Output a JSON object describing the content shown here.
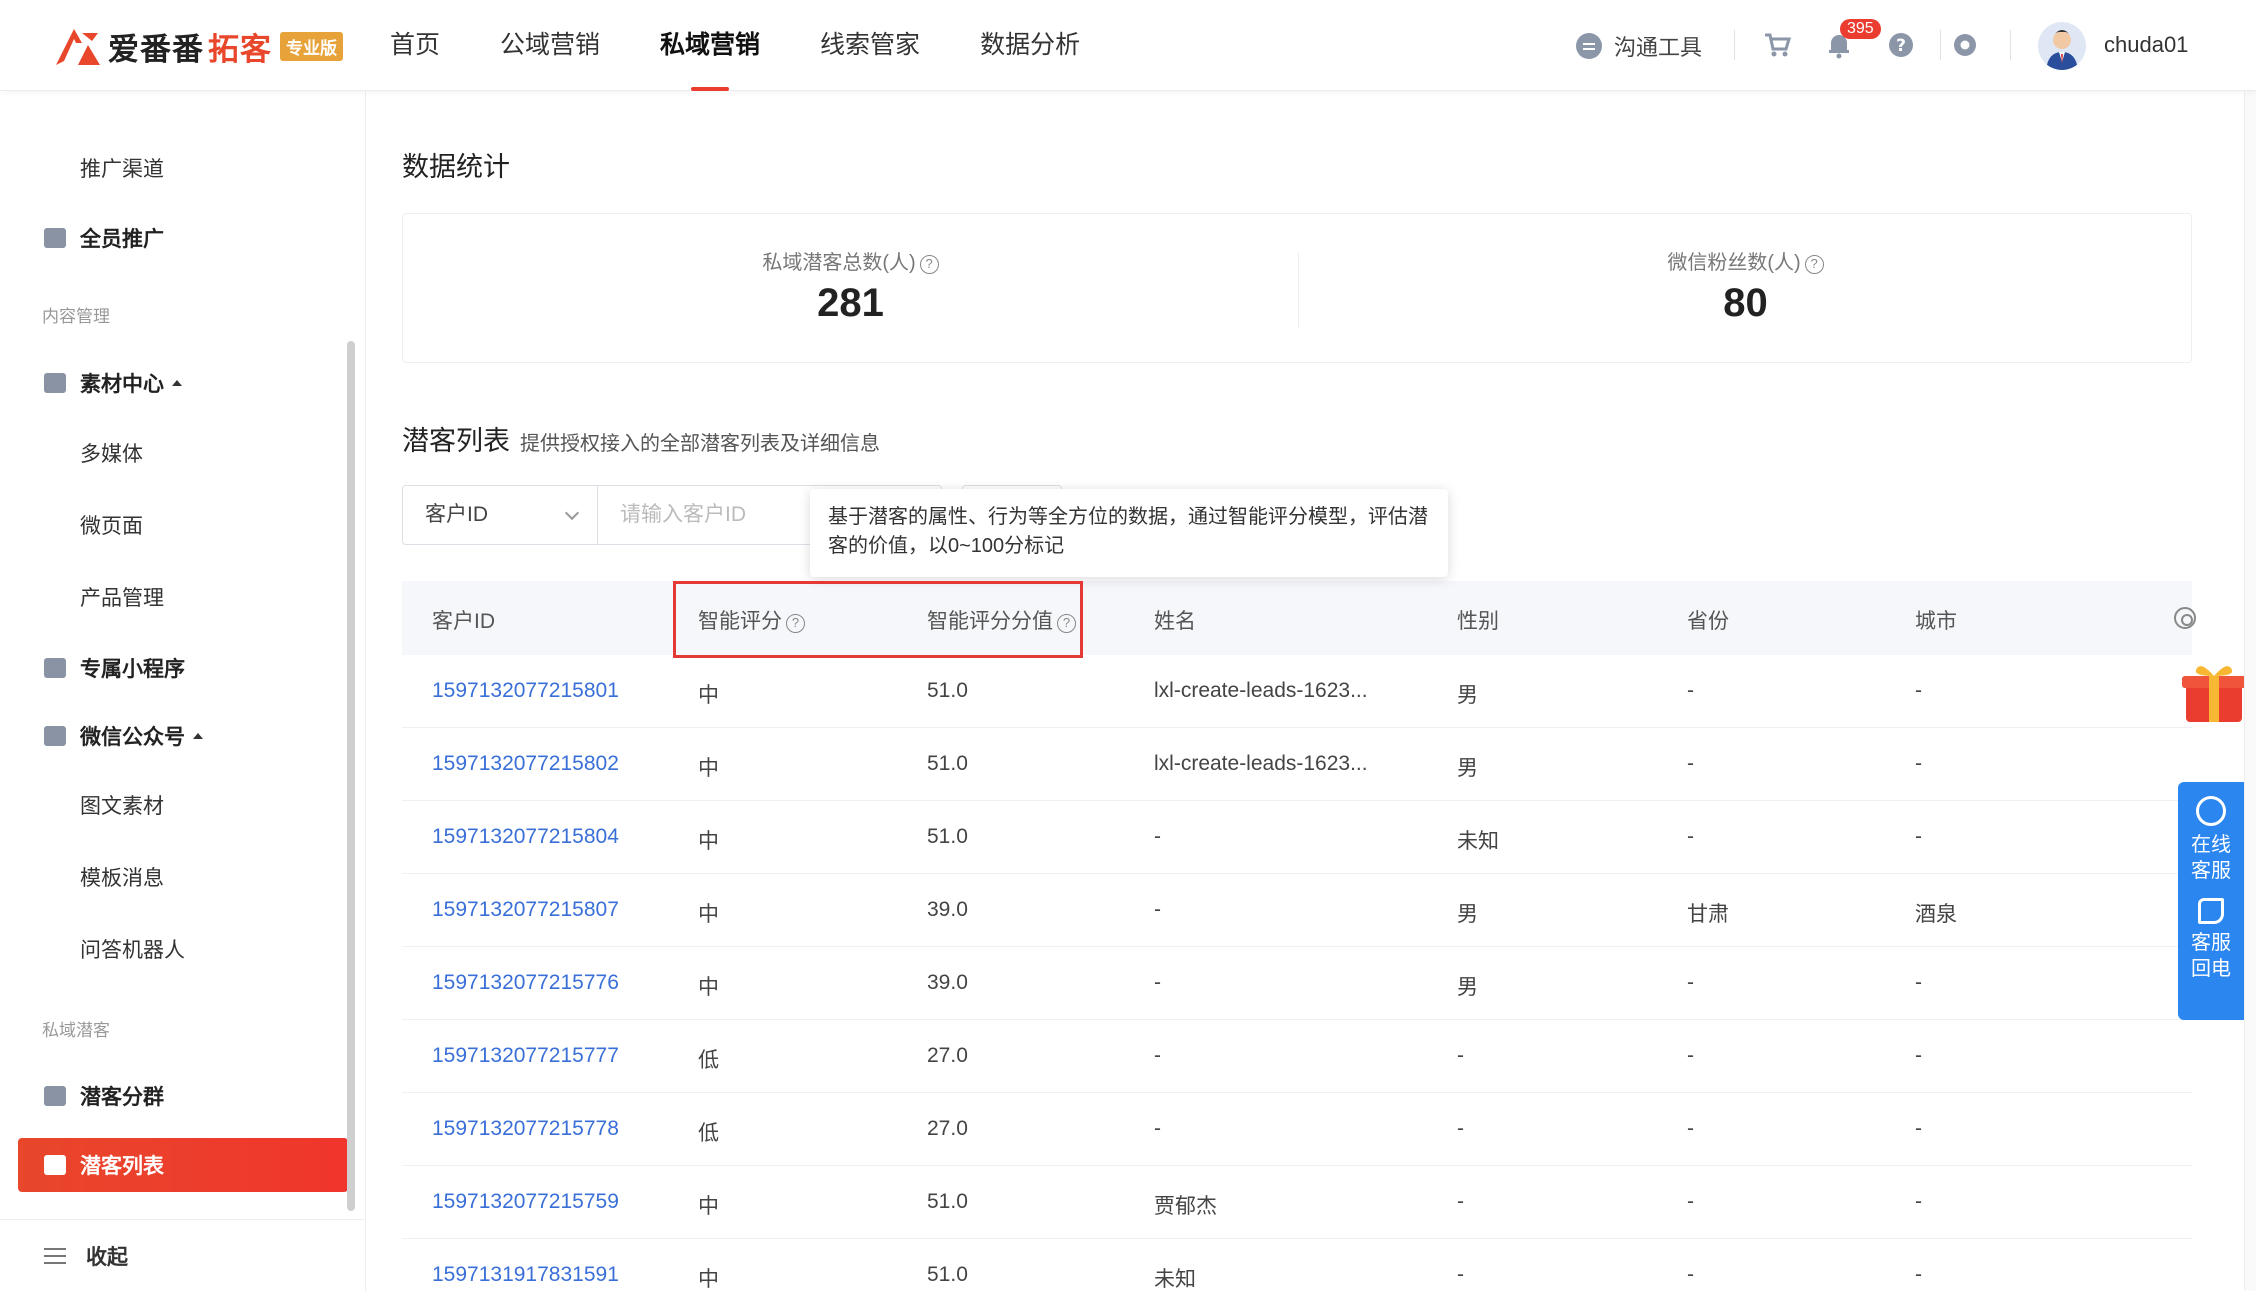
{
  "header": {
    "brand": "爱番番",
    "brand_product": "拓客",
    "brand_badge": "专业版",
    "nav": [
      {
        "label": "首页",
        "active": false
      },
      {
        "label": "公域营销",
        "active": false
      },
      {
        "label": "私域营销",
        "active": true
      },
      {
        "label": "线索管家",
        "active": false
      },
      {
        "label": "数据分析",
        "active": false
      }
    ],
    "comm_tool": "沟通工具",
    "notification_count": "395",
    "username": "chuda01"
  },
  "sidebar": {
    "items": {
      "promo_channel": "推广渠道",
      "all_staff": "全员推广",
      "group_content": "内容管理",
      "material_center": "素材中心",
      "multimedia": "多媒体",
      "micro_page": "微页面",
      "product_mgmt": "产品管理",
      "mini_program": "专属小程序",
      "wechat_official": "微信公众号",
      "image_text": "图文素材",
      "template_msg": "模板消息",
      "qa_bot": "问答机器人",
      "group_private": "私域潜客",
      "lead_group": "潜客分群",
      "lead_list": "潜客列表"
    },
    "collapse": "收起"
  },
  "main": {
    "stats_title": "数据统计",
    "stats": [
      {
        "label": "私域潜客总数(人)",
        "value": "281"
      },
      {
        "label": "微信粉丝数(人)",
        "value": "80"
      }
    ],
    "list_title": "潜客列表",
    "list_subtitle": "提供授权接入的全部潜客列表及详细信息",
    "filter": {
      "select_value": "客户ID",
      "input_placeholder": "请输入客户ID"
    },
    "tooltip": "基于潜客的属性、行为等全方位的数据，通过智能评分模型，评估潜客的价值，以0~100分标记",
    "columns": [
      "客户ID",
      "智能评分",
      "智能评分分值",
      "姓名",
      "性别",
      "省份",
      "城市"
    ],
    "rows": [
      {
        "id": "1597132077215801",
        "score": "中",
        "score_value": "51.0",
        "name": "lxl-create-leads-1623...",
        "gender": "男",
        "province": "-",
        "city": "-"
      },
      {
        "id": "1597132077215802",
        "score": "中",
        "score_value": "51.0",
        "name": "lxl-create-leads-1623...",
        "gender": "男",
        "province": "-",
        "city": "-"
      },
      {
        "id": "1597132077215804",
        "score": "中",
        "score_value": "51.0",
        "name": "-",
        "gender": "未知",
        "province": "-",
        "city": "-"
      },
      {
        "id": "1597132077215807",
        "score": "中",
        "score_value": "39.0",
        "name": "-",
        "gender": "男",
        "province": "甘肃",
        "city": "酒泉"
      },
      {
        "id": "1597132077215776",
        "score": "中",
        "score_value": "39.0",
        "name": "-",
        "gender": "男",
        "province": "-",
        "city": "-"
      },
      {
        "id": "1597132077215777",
        "score": "低",
        "score_value": "27.0",
        "name": "-",
        "gender": "-",
        "province": "-",
        "city": "-"
      },
      {
        "id": "1597132077215778",
        "score": "低",
        "score_value": "27.0",
        "name": "-",
        "gender": "-",
        "province": "-",
        "city": "-"
      },
      {
        "id": "1597132077215759",
        "score": "中",
        "score_value": "51.0",
        "name": "贾郁杰",
        "gender": "-",
        "province": "-",
        "city": "-"
      },
      {
        "id": "1597131917831591",
        "score": "中",
        "score_value": "51.0",
        "name": "未知",
        "gender": "-",
        "province": "-",
        "city": "-"
      }
    ]
  },
  "float": {
    "online_service": "在线客服",
    "callback": "客服回电"
  },
  "colors": {
    "brand_red": "#ea3d2f",
    "link_blue": "#3a6fd8",
    "service_blue": "#2b86f0"
  }
}
